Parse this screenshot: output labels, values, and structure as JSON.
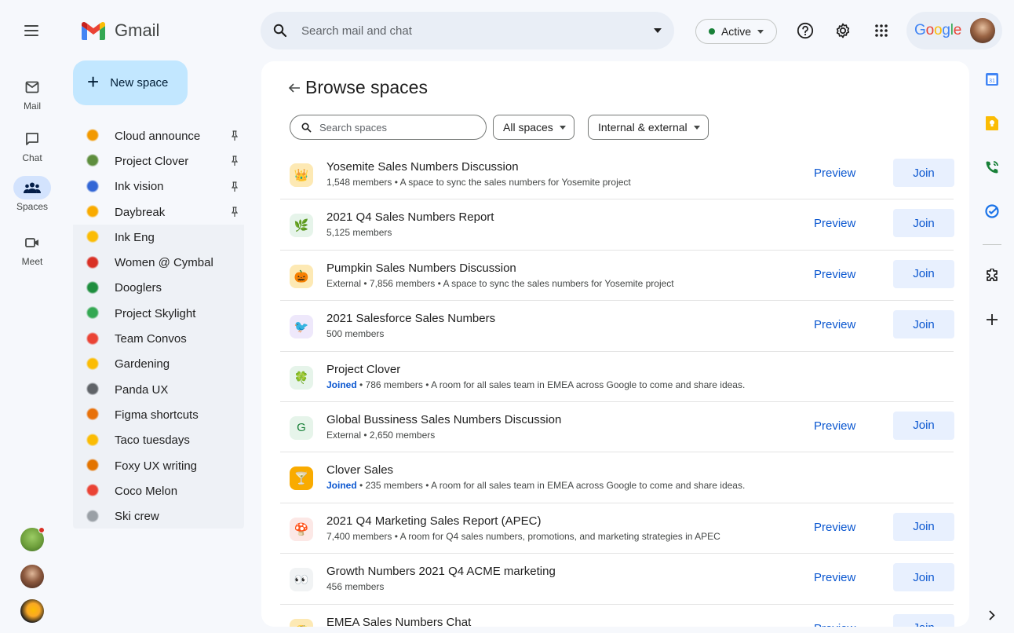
{
  "app": {
    "name": "Gmail"
  },
  "rail": {
    "items": [
      {
        "label": "Mail",
        "icon": "mail-icon"
      },
      {
        "label": "Chat",
        "icon": "chat-icon"
      },
      {
        "label": "Spaces",
        "icon": "spaces-icon",
        "active": true
      },
      {
        "label": "Meet",
        "icon": "meet-icon"
      }
    ]
  },
  "search": {
    "placeholder": "Search mail and chat"
  },
  "status": {
    "label": "Active",
    "color": "#188038"
  },
  "account": {
    "brand": "Google"
  },
  "new_space": {
    "label": "New space"
  },
  "spaces": [
    {
      "name": "Cloud announce",
      "pinned": true
    },
    {
      "name": "Project Clover",
      "pinned": true
    },
    {
      "name": "Ink vision",
      "pinned": true
    },
    {
      "name": "Daybreak",
      "pinned": true
    },
    {
      "name": "Ink Eng"
    },
    {
      "name": "Women @ Cymbal"
    },
    {
      "name": "Dooglers"
    },
    {
      "name": "Project Skylight"
    },
    {
      "name": "Team Convos"
    },
    {
      "name": "Gardening"
    },
    {
      "name": "Panda UX"
    },
    {
      "name": "Figma shortcuts"
    },
    {
      "name": "Taco tuesdays"
    },
    {
      "name": "Foxy UX writing"
    },
    {
      "name": "Coco Melon"
    },
    {
      "name": "Ski crew"
    }
  ],
  "browse": {
    "title": "Browse spaces",
    "search_placeholder": "Search spaces",
    "filters": [
      "All spaces",
      "Internal & external"
    ],
    "preview_label": "Preview",
    "join_label": "Join",
    "rows": [
      {
        "name": "Yosemite Sales Numbers Discussion",
        "joined": "",
        "desc": "1,548 members • A space to sync the sales numbers for Yosemite project",
        "actions": true
      },
      {
        "name": "2021 Q4 Sales Numbers Report",
        "joined": "",
        "desc": "5,125 members",
        "actions": true
      },
      {
        "name": "Pumpkin Sales Numbers Discussion",
        "joined": "",
        "desc": "External • 7,856 members •  A space to sync the sales numbers for Yosemite project",
        "actions": true
      },
      {
        "name": "2021 Salesforce Sales Numbers",
        "joined": "",
        "desc": "500 members",
        "actions": true
      },
      {
        "name": "Project Clover",
        "joined": "Joined",
        "desc": " • 786 members • A room for all sales team in EMEA across Google to come and share ideas.",
        "actions": false
      },
      {
        "name": "Global Bussiness Sales Numbers Discussion",
        "joined": "",
        "desc": "External • 2,650 members",
        "actions": true
      },
      {
        "name": "Clover Sales",
        "joined": "Joined",
        "desc": " •  235 members • A room for all sales team in EMEA across Google to come and share ideas.",
        "actions": false
      },
      {
        "name": "2021 Q4 Marketing Sales Report (APEC)",
        "joined": "",
        "desc": "7,400 members • A room for Q4 sales numbers, promotions, and marketing strategies in APEC",
        "actions": true
      },
      {
        "name": "Growth Numbers 2021 Q4  ACME marketing",
        "joined": "",
        "desc": "456 members",
        "actions": true
      },
      {
        "name": "EMEA Sales Numbers Chat",
        "joined": "",
        "desc": "",
        "actions": true
      }
    ]
  },
  "row_avatars": [
    {
      "glyph": "👑",
      "bg": "#fde9b4"
    },
    {
      "glyph": "🌿",
      "bg": "#e6f4ea"
    },
    {
      "glyph": "🎃",
      "bg": "#fde9b4"
    },
    {
      "glyph": "🐦",
      "bg": "#eee8fb"
    },
    {
      "glyph": "🍀",
      "bg": "#e6f4ea"
    },
    {
      "glyph": "G",
      "bg": "#e6f4ea"
    },
    {
      "glyph": "🍸",
      "bg": "#f9ab00"
    },
    {
      "glyph": "🍄",
      "bg": "#fce8e6"
    },
    {
      "glyph": "👀",
      "bg": "#f1f3f4"
    },
    {
      "glyph": "🌮",
      "bg": "#fde9b4"
    }
  ],
  "colors": {
    "accent": "#0b57d0",
    "new_space_bg": "#c2e7ff",
    "rail_active_bg": "#d3e3fd",
    "join_bg": "#e8f0fe"
  }
}
